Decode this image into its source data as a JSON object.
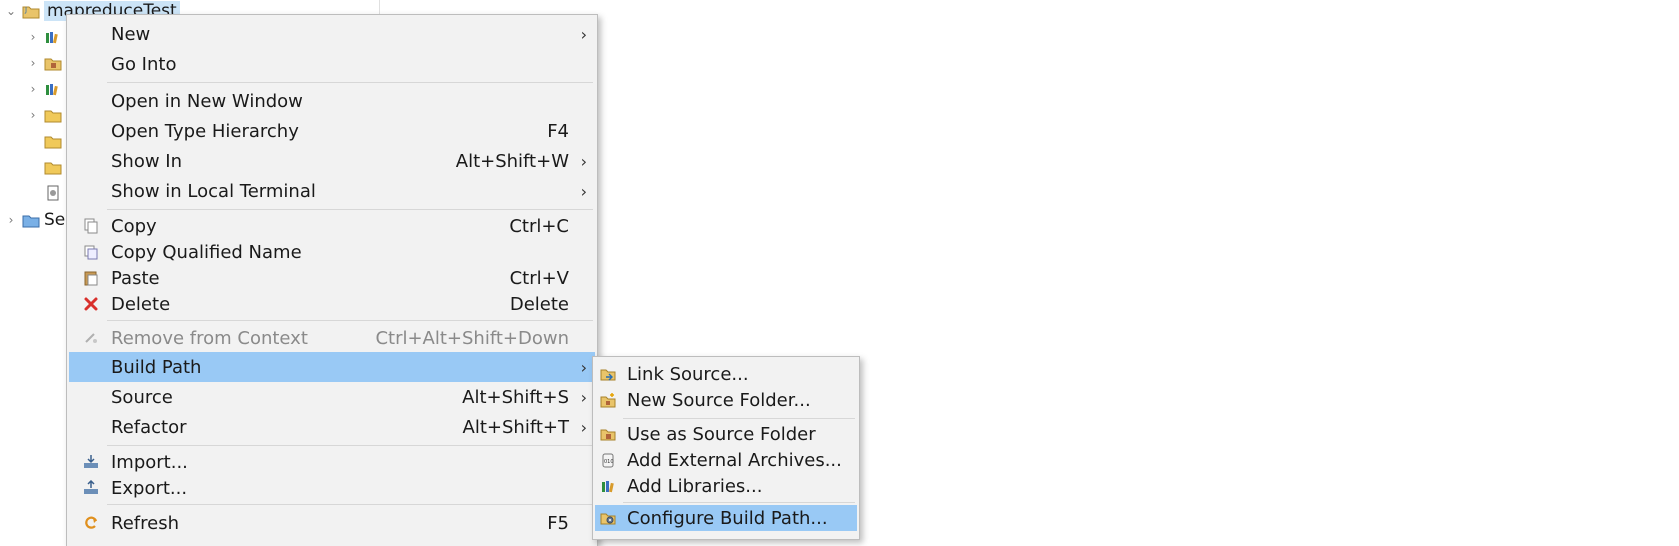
{
  "tree": {
    "project_label": "mapreduceTest",
    "second_project_label": "Se"
  },
  "context_menu": {
    "items": [
      {
        "label": "New",
        "shortcut": "",
        "submenu": true
      },
      {
        "label": "Go Into",
        "shortcut": "",
        "submenu": false
      },
      {
        "label": "Open in New Window",
        "shortcut": "",
        "submenu": false
      },
      {
        "label": "Open Type Hierarchy",
        "shortcut": "F4",
        "submenu": false
      },
      {
        "label": "Show In",
        "shortcut": "Alt+Shift+W",
        "submenu": true
      },
      {
        "label": "Show in Local Terminal",
        "shortcut": "",
        "submenu": true
      },
      {
        "label": "Copy",
        "shortcut": "Ctrl+C",
        "submenu": false,
        "icon": "copy-icon"
      },
      {
        "label": "Copy Qualified Name",
        "shortcut": "",
        "submenu": false,
        "icon": "copy-qualified-icon"
      },
      {
        "label": "Paste",
        "shortcut": "Ctrl+V",
        "submenu": false,
        "icon": "paste-icon"
      },
      {
        "label": "Delete",
        "shortcut": "Delete",
        "submenu": false,
        "icon": "delete-icon"
      },
      {
        "label": "Remove from Context",
        "shortcut": "Ctrl+Alt+Shift+Down",
        "submenu": false,
        "disabled": true
      },
      {
        "label": "Build Path",
        "shortcut": "",
        "submenu": true,
        "selected": true
      },
      {
        "label": "Source",
        "shortcut": "Alt+Shift+S",
        "submenu": true
      },
      {
        "label": "Refactor",
        "shortcut": "Alt+Shift+T",
        "submenu": true
      },
      {
        "label": "Import...",
        "shortcut": "",
        "submenu": false,
        "icon": "import-icon"
      },
      {
        "label": "Export...",
        "shortcut": "",
        "submenu": false,
        "icon": "export-icon"
      },
      {
        "label": "Refresh",
        "shortcut": "F5",
        "submenu": false,
        "icon": "refresh-icon"
      }
    ]
  },
  "build_path_submenu": {
    "items": [
      {
        "label": "Link Source...",
        "icon": "link-source-icon"
      },
      {
        "label": "New Source Folder...",
        "icon": "new-source-folder-icon"
      },
      {
        "label": "Use as Source Folder",
        "icon": "source-folder-icon"
      },
      {
        "label": "Add External Archives...",
        "icon": "jar-icon"
      },
      {
        "label": "Add Libraries...",
        "icon": "library-icon"
      },
      {
        "label": "Configure Build Path...",
        "icon": "configure-build-path-icon",
        "selected": true
      }
    ]
  },
  "colors": {
    "selection": "#99c9f5",
    "menu_bg": "#f2f2f2",
    "tree_selection": "#cce4f7"
  }
}
